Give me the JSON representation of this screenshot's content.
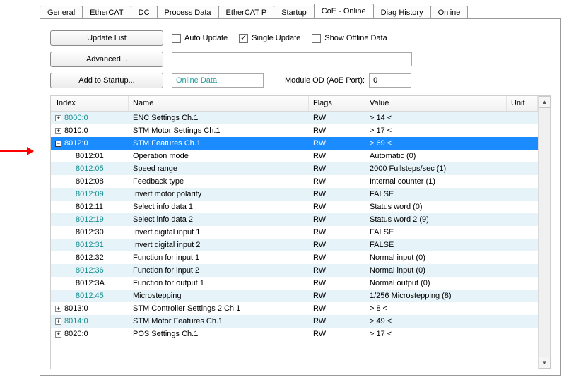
{
  "tabs": [
    "General",
    "EtherCAT",
    "DC",
    "Process Data",
    "EtherCAT P",
    "Startup",
    "CoE - Online",
    "Diag History",
    "Online"
  ],
  "active_tab": "CoE - Online",
  "buttons": {
    "update_list": "Update List",
    "advanced": "Advanced...",
    "add_to_startup": "Add to Startup..."
  },
  "checks": {
    "auto_update": {
      "label": "Auto Update",
      "checked": false
    },
    "single_update": {
      "label": "Single Update",
      "checked": true
    },
    "show_offline": {
      "label": "Show Offline Data",
      "checked": false
    }
  },
  "fields": {
    "filter": "",
    "online_data": "Online Data",
    "module_od_label": "Module OD (AoE Port):",
    "module_od_value": "0"
  },
  "headers": {
    "index": "Index",
    "name": "Name",
    "flags": "Flags",
    "value": "Value",
    "unit": "Unit"
  },
  "rows": [
    {
      "stripe": "A",
      "lvl": 0,
      "exp": "plus",
      "teal": true,
      "index": "8000:0",
      "name": "ENC Settings Ch.1",
      "flags": "RW",
      "value": "> 14 <",
      "sel": false
    },
    {
      "stripe": "B",
      "lvl": 0,
      "exp": "plus",
      "teal": false,
      "index": "8010:0",
      "name": "STM Motor Settings Ch.1",
      "flags": "RW",
      "value": "> 17 <",
      "sel": false
    },
    {
      "stripe": "A",
      "lvl": 0,
      "exp": "minus",
      "teal": true,
      "index": "8012:0",
      "name": "STM Features Ch.1",
      "flags": "RW",
      "value": "> 69 <",
      "sel": true
    },
    {
      "stripe": "B",
      "lvl": 1,
      "exp": "",
      "teal": false,
      "index": "8012:01",
      "name": "Operation mode",
      "flags": "RW",
      "value": "Automatic (0)",
      "sel": false
    },
    {
      "stripe": "A",
      "lvl": 1,
      "exp": "",
      "teal": true,
      "index": "8012:05",
      "name": "Speed range",
      "flags": "RW",
      "value": "2000 Fullsteps/sec (1)",
      "sel": false
    },
    {
      "stripe": "B",
      "lvl": 1,
      "exp": "",
      "teal": false,
      "index": "8012:08",
      "name": "Feedback type",
      "flags": "RW",
      "value": "Internal counter (1)",
      "sel": false
    },
    {
      "stripe": "A",
      "lvl": 1,
      "exp": "",
      "teal": true,
      "index": "8012:09",
      "name": "Invert motor polarity",
      "flags": "RW",
      "value": "FALSE",
      "sel": false
    },
    {
      "stripe": "B",
      "lvl": 1,
      "exp": "",
      "teal": false,
      "index": "8012:11",
      "name": "Select info data 1",
      "flags": "RW",
      "value": "Status word (0)",
      "sel": false
    },
    {
      "stripe": "A",
      "lvl": 1,
      "exp": "",
      "teal": true,
      "index": "8012:19",
      "name": "Select info data 2",
      "flags": "RW",
      "value": "Status word 2 (9)",
      "sel": false
    },
    {
      "stripe": "B",
      "lvl": 1,
      "exp": "",
      "teal": false,
      "index": "8012:30",
      "name": "Invert digital input 1",
      "flags": "RW",
      "value": "FALSE",
      "sel": false
    },
    {
      "stripe": "A",
      "lvl": 1,
      "exp": "",
      "teal": true,
      "index": "8012:31",
      "name": "Invert digital input 2",
      "flags": "RW",
      "value": "FALSE",
      "sel": false
    },
    {
      "stripe": "B",
      "lvl": 1,
      "exp": "",
      "teal": false,
      "index": "8012:32",
      "name": "Function for input 1",
      "flags": "RW",
      "value": "Normal input (0)",
      "sel": false
    },
    {
      "stripe": "A",
      "lvl": 1,
      "exp": "",
      "teal": true,
      "index": "8012:36",
      "name": "Function for input 2",
      "flags": "RW",
      "value": "Normal input (0)",
      "sel": false
    },
    {
      "stripe": "B",
      "lvl": 1,
      "exp": "",
      "teal": false,
      "index": "8012:3A",
      "name": "Function for output 1",
      "flags": "RW",
      "value": "Normal output (0)",
      "sel": false
    },
    {
      "stripe": "A",
      "lvl": 1,
      "exp": "",
      "teal": true,
      "index": "8012:45",
      "name": "Microstepping",
      "flags": "RW",
      "value": "1/256 Microstepping (8)",
      "sel": false
    },
    {
      "stripe": "B",
      "lvl": 0,
      "exp": "plus",
      "teal": false,
      "index": "8013:0",
      "name": "STM Controller Settings 2 Ch.1",
      "flags": "RW",
      "value": "> 8 <",
      "sel": false
    },
    {
      "stripe": "A",
      "lvl": 0,
      "exp": "plus",
      "teal": true,
      "index": "8014:0",
      "name": "STM Motor Features Ch.1",
      "flags": "RW",
      "value": "> 49 <",
      "sel": false
    },
    {
      "stripe": "B",
      "lvl": 0,
      "exp": "plus",
      "teal": false,
      "index": "8020:0",
      "name": "POS Settings Ch.1",
      "flags": "RW",
      "value": "> 17 <",
      "sel": false
    }
  ]
}
